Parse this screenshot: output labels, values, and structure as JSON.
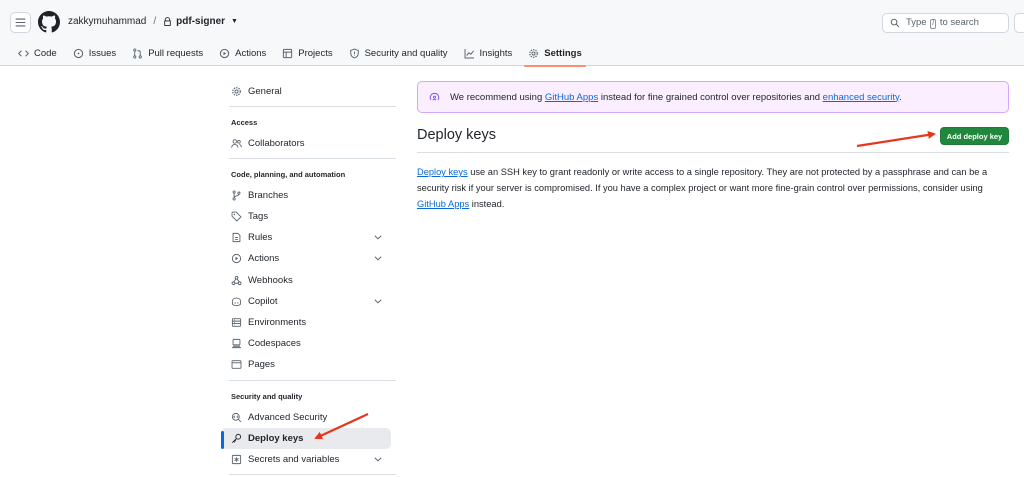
{
  "header": {
    "owner": "zakkymuhammad",
    "separator": "/",
    "repo": "pdf-signer",
    "search_prefix": "Type",
    "search_key": "/",
    "search_suffix": "to search"
  },
  "tabs": [
    {
      "label": "Code",
      "icon": "code-icon"
    },
    {
      "label": "Issues",
      "icon": "issue-icon"
    },
    {
      "label": "Pull requests",
      "icon": "pull-request-icon"
    },
    {
      "label": "Actions",
      "icon": "play-icon"
    },
    {
      "label": "Projects",
      "icon": "table-icon"
    },
    {
      "label": "Security and quality",
      "icon": "shield-icon"
    },
    {
      "label": "Insights",
      "icon": "graph-icon"
    },
    {
      "label": "Settings",
      "icon": "gear-icon",
      "active": true
    }
  ],
  "sidebar": {
    "general": "General",
    "access_title": "Access",
    "collaborators": "Collaborators",
    "code_title": "Code, planning, and automation",
    "branches": "Branches",
    "tags": "Tags",
    "rules": "Rules",
    "actions": "Actions",
    "webhooks": "Webhooks",
    "copilot": "Copilot",
    "environments": "Environments",
    "codespaces": "Codespaces",
    "pages": "Pages",
    "security_title": "Security and quality",
    "advanced_security": "Advanced Security",
    "deploy_keys": "Deploy keys",
    "secrets": "Secrets and variables"
  },
  "flash": {
    "text1": "We recommend using",
    "link1": "GitHub Apps",
    "text2": "instead for fine grained control over repositories and",
    "link2": "enhanced security",
    "text3": "."
  },
  "main": {
    "title": "Deploy keys",
    "add_button": "Add deploy key",
    "desc_link1": "Deploy keys",
    "desc_text1": " use an SSH key to grant readonly or write access to a single repository. They are not protected by a passphrase and can be a security risk if your server is compromised. If you have a complex project or want more fine-grain control over permissions, consider using ",
    "desc_link2": "GitHub Apps",
    "desc_text2": " instead."
  },
  "colors": {
    "accent_green": "#1f883d",
    "link_blue": "#0969da",
    "annotation_red": "#e8361d",
    "active_tab_underline": "#fd8c73"
  }
}
